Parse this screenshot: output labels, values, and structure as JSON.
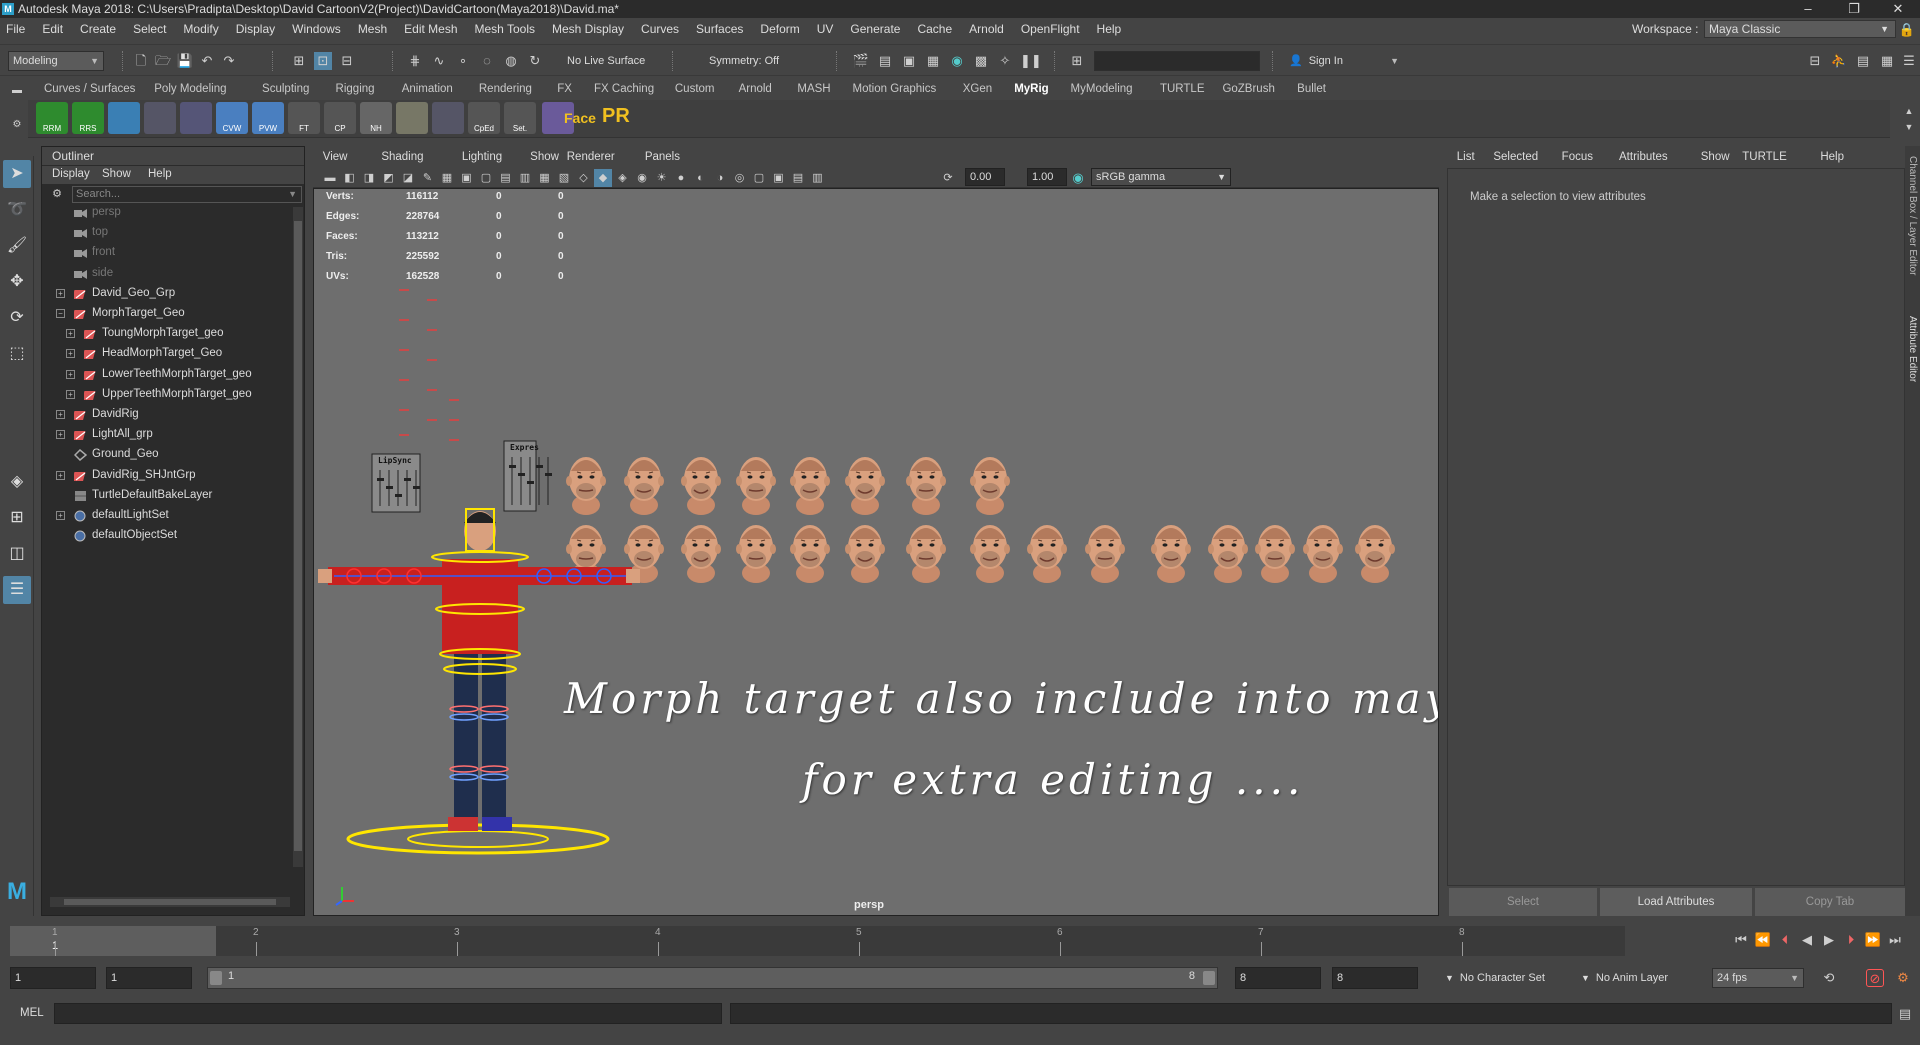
{
  "window": {
    "title": "Autodesk Maya 2018: C:\\Users\\Pradipta\\Desktop\\David CartoonV2(Project)\\DavidCartoon(Maya2018)\\David.ma*"
  },
  "menubar": {
    "items": [
      "File",
      "Edit",
      "Create",
      "Select",
      "Modify",
      "Display",
      "Windows",
      "Mesh",
      "Edit Mesh",
      "Mesh Tools",
      "Mesh Display",
      "Curves",
      "Surfaces",
      "Deform",
      "UV",
      "Generate",
      "Cache",
      "Arnold",
      "OpenFlight",
      "Help"
    ],
    "workspace_label": "Workspace :",
    "workspace_value": "Maya Classic"
  },
  "statusline": {
    "mode": "Modeling",
    "live_surface": "No Live Surface",
    "symmetry": "Symmetry: Off",
    "sign_in": "Sign In"
  },
  "shelf": {
    "tabs": [
      "Curves / Surfaces",
      "Poly Modeling",
      "Sculpting",
      "Rigging",
      "Animation",
      "Rendering",
      "FX",
      "FX Caching",
      "Custom",
      "Arnold",
      "MASH",
      "Motion Graphics",
      "XGen",
      "MyRig",
      "MyModeling",
      "TURTLE",
      "GoZBrush",
      "Bullet"
    ],
    "active_tab": "MyRig",
    "buttons": [
      "RRM",
      "RRS",
      "",
      "",
      "",
      "CVW",
      "PVW",
      "FT",
      "CP",
      "NH",
      "",
      "",
      "CpEd",
      "Set.",
      ""
    ],
    "face_label": "Face",
    "pr_label": "PR"
  },
  "outliner": {
    "title": "Outliner",
    "menu": [
      "Display",
      "Show",
      "Help"
    ],
    "search_placeholder": "Search...",
    "items": [
      {
        "name": "persp",
        "indent": 1,
        "icon": "camera-icon",
        "expand": false,
        "dim": true
      },
      {
        "name": "top",
        "indent": 1,
        "icon": "camera-icon",
        "expand": false,
        "dim": true
      },
      {
        "name": "front",
        "indent": 1,
        "icon": "camera-icon",
        "expand": false,
        "dim": true
      },
      {
        "name": "side",
        "indent": 1,
        "icon": "camera-icon",
        "expand": false,
        "dim": true
      },
      {
        "name": "David_Geo_Grp",
        "indent": 1,
        "icon": "group-icon",
        "expand": true,
        "sign": "+"
      },
      {
        "name": "MorphTarget_Geo",
        "indent": 1,
        "icon": "group-icon",
        "expand": true,
        "sign": "−"
      },
      {
        "name": "ToungMorphTarget_geo",
        "indent": 2,
        "icon": "group-icon",
        "expand": true,
        "sign": "+"
      },
      {
        "name": "HeadMorphTarget_Geo",
        "indent": 2,
        "icon": "group-icon",
        "expand": true,
        "sign": "+"
      },
      {
        "name": "LowerTeethMorphTarget_geo",
        "indent": 2,
        "icon": "group-icon",
        "expand": true,
        "sign": "+"
      },
      {
        "name": "UpperTeethMorphTarget_geo",
        "indent": 2,
        "icon": "group-icon",
        "expand": true,
        "sign": "+"
      },
      {
        "name": "DavidRig",
        "indent": 1,
        "icon": "group-icon",
        "expand": true,
        "sign": "+"
      },
      {
        "name": "LightAll_grp",
        "indent": 1,
        "icon": "group-icon",
        "expand": true,
        "sign": "+"
      },
      {
        "name": "Ground_Geo",
        "indent": 1,
        "icon": "curve-icon",
        "expand": false
      },
      {
        "name": "DavidRig_SHJntGrp",
        "indent": 1,
        "icon": "group-icon",
        "expand": true,
        "sign": "+"
      },
      {
        "name": "TurtleDefaultBakeLayer",
        "indent": 1,
        "icon": "layer-icon",
        "expand": false
      },
      {
        "name": "defaultLightSet",
        "indent": 1,
        "icon": "set-icon",
        "expand": true,
        "sign": "+"
      },
      {
        "name": "defaultObjectSet",
        "indent": 1,
        "icon": "set-icon",
        "expand": false
      }
    ]
  },
  "viewport": {
    "menu": [
      "View",
      "Shading",
      "Lighting",
      "Show",
      "Renderer",
      "Panels"
    ],
    "exposure": "0.00",
    "gamma": "1.00",
    "color_space": "sRGB gamma",
    "hud": [
      {
        "label": "Verts:",
        "a": "116112",
        "b": "0",
        "c": "0"
      },
      {
        "label": "Edges:",
        "a": "228764",
        "b": "0",
        "c": "0"
      },
      {
        "label": "Faces:",
        "a": "113212",
        "b": "0",
        "c": "0"
      },
      {
        "label": "Tris:",
        "a": "225592",
        "b": "0",
        "c": "0"
      },
      {
        "label": "UVs:",
        "a": "162528",
        "b": "0",
        "c": "0"
      }
    ],
    "panel_labels": [
      "LipSync",
      "Expres"
    ],
    "camera_label": "persp",
    "overlay_line1": "Morph target also include into maya file",
    "overlay_line2": "for extra editing ....",
    "head_rows": [
      8,
      15
    ]
  },
  "attribute_panel": {
    "menu": [
      "List",
      "Selected",
      "Focus",
      "Attributes",
      "Show",
      "TURTLE",
      "Help"
    ],
    "message": "Make a selection to view attributes",
    "buttons": [
      "Select",
      "Load Attributes",
      "Copy Tab"
    ],
    "side_tabs": [
      "Channel Box / Layer Editor",
      "Attribute Editor"
    ]
  },
  "timeline": {
    "current_frame": "1",
    "ticks": [
      "1",
      "2",
      "3",
      "4",
      "5",
      "6",
      "7",
      "8"
    ],
    "current_field": "1"
  },
  "range": {
    "start": "1",
    "playback_start": "1",
    "slider_start": "1",
    "slider_end": "8",
    "playback_end": "8",
    "end": "8",
    "character_set": "No Character Set",
    "anim_layer": "No Anim Layer",
    "fps": "24 fps"
  },
  "cmdline": {
    "label": "MEL"
  }
}
